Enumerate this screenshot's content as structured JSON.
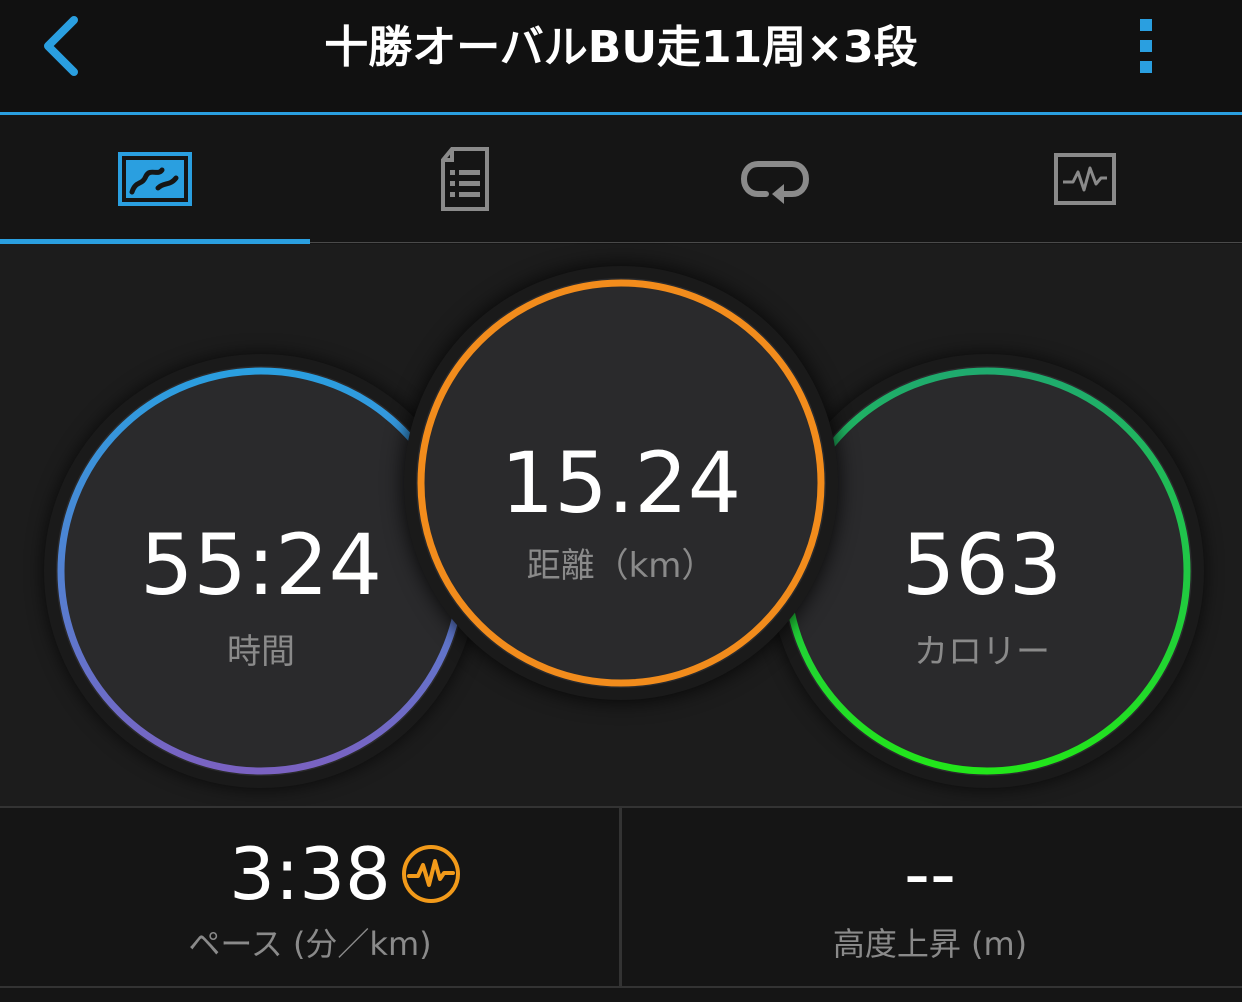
{
  "header": {
    "title": "十勝オーバルBU走11周×3段",
    "back_icon": "chevron-left-icon",
    "more_icon": "more-vertical-icon",
    "accent_color": "#2a9fe0"
  },
  "tabs": [
    {
      "name": "overview",
      "icon": "activity-map-icon",
      "selected": true
    },
    {
      "name": "details",
      "icon": "document-list-icon",
      "selected": false
    },
    {
      "name": "laps",
      "icon": "repeat-laps-icon",
      "selected": false
    },
    {
      "name": "charts",
      "icon": "chart-monitor-icon",
      "selected": false
    }
  ],
  "stats": {
    "time": {
      "value": "55:24",
      "label": "時間",
      "colors": [
        "#2a9fe0",
        "#7a62c2"
      ]
    },
    "distance": {
      "value": "15.24",
      "label": "距離（km）",
      "color": "#f28c1c"
    },
    "calories": {
      "value": "563",
      "label": "カロリー",
      "colors": [
        "#1faa6e",
        "#22e61a"
      ]
    }
  },
  "bottom": {
    "pace": {
      "value": "3:38",
      "label": "ペース (分／km)",
      "icon": "heart-rate-zone-icon",
      "icon_color": "#f29a1a"
    },
    "elevation": {
      "value": "--",
      "label": "高度上昇 (m)"
    }
  }
}
